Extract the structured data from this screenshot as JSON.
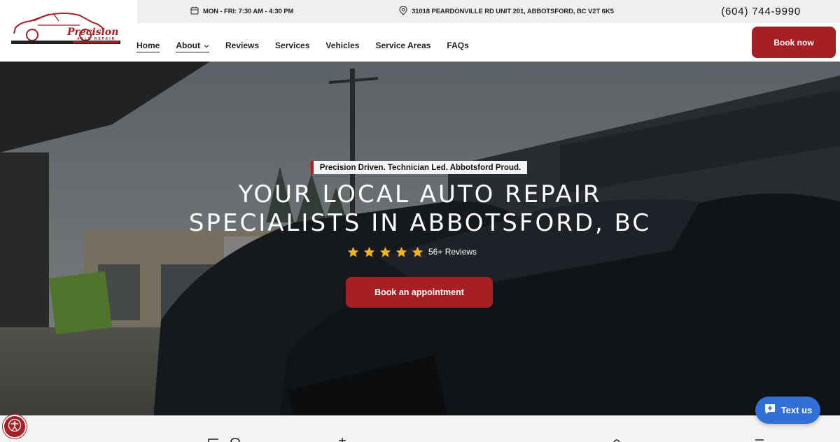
{
  "topbar": {
    "hours": "MON - FRI: 7:30 AM - 4:30 PM",
    "address": "31018 PEARDONVILLE RD UNIT 201, ABBOTSFORD, BC V2T 6K5",
    "phone": "(604) 744-9990"
  },
  "logo": {
    "brand": "Precision",
    "sub": "AXLE REPAIR"
  },
  "nav": {
    "items": [
      {
        "label": "Home",
        "active": true
      },
      {
        "label": "About",
        "has_dropdown": true
      },
      {
        "label": "Reviews"
      },
      {
        "label": "Services"
      },
      {
        "label": "Vehicles"
      },
      {
        "label": "Service Areas"
      },
      {
        "label": "FAQs"
      }
    ],
    "book_now": "Book now"
  },
  "hero": {
    "tagline": "Precision Driven. Technician Led. Abbotsford Proud.",
    "headline_line1": "YOUR LOCAL AUTO REPAIR",
    "headline_line2": "SPECIALISTS IN ABBOTSFORD, BC",
    "rating": {
      "stars": 5,
      "reviews_label": "56+ Reviews"
    },
    "cta": "Book an appointment"
  },
  "widgets": {
    "text_us": "Text us",
    "accessibility_icon": "accessibility-icon",
    "chat_icon": "chat-plus-icon"
  },
  "colors": {
    "brand_red": "#a51f25",
    "chat_blue": "#2f6fd6",
    "star_gold": "#f5b419"
  }
}
